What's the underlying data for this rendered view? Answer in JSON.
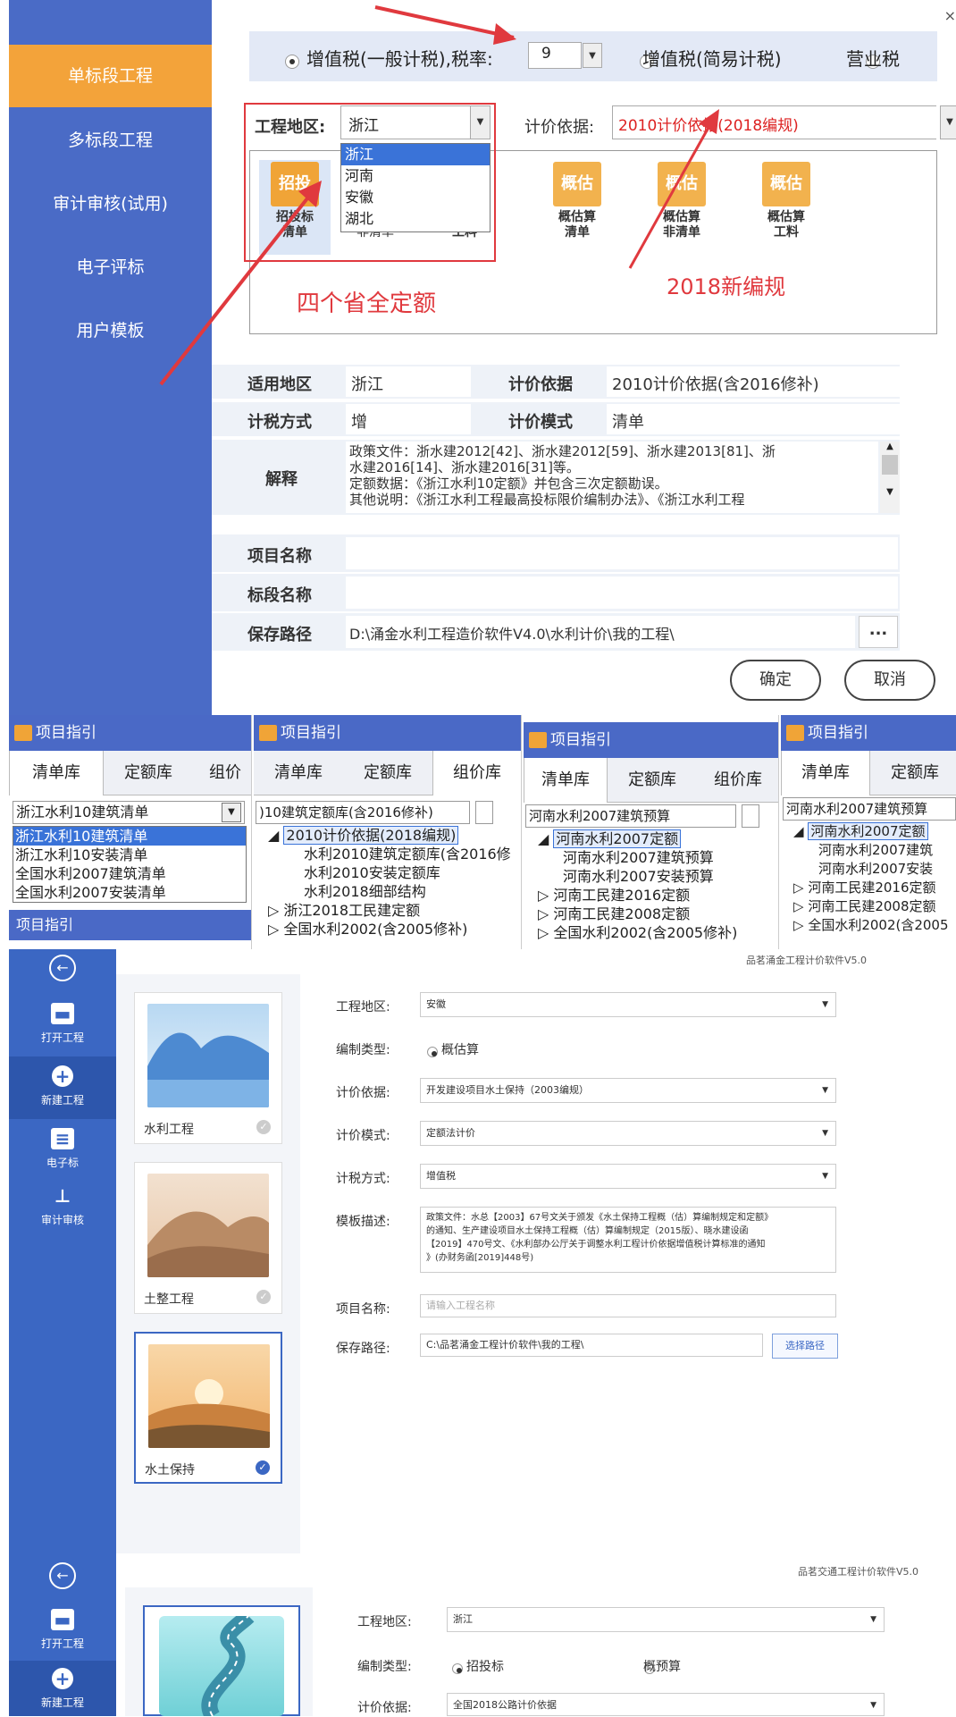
{
  "s1": {
    "sidebar": [
      "单标段工程",
      "多标段工程",
      "审计审核(试用)",
      "电子评标",
      "用户模板"
    ],
    "tax": {
      "opt1": "增值税(一般计税),税率:",
      "rate": "9",
      "opt2": "增值税(简易计税)",
      "opt3": "营业税"
    },
    "region_label": "工程地区:",
    "region_value": "浙江",
    "basis_label": "计价依据:",
    "basis_value": "2010计价依据(2018编规)",
    "region_options": [
      "浙江",
      "河南",
      "安徽",
      "湖北"
    ],
    "templates": [
      {
        "icon": "招投",
        "name": "招投标\n清单"
      },
      {
        "icon": "招投",
        "name": "\n非清单"
      },
      {
        "icon": "招投",
        "name": "招投标\n工料"
      },
      {
        "icon": "概估",
        "name": "概估算\n清单"
      },
      {
        "icon": "概估",
        "name": "概估算\n非清单"
      },
      {
        "icon": "概估",
        "name": "概估算\n工料"
      }
    ],
    "annot_left": "四个省全定额",
    "annot_right": "2018新编规",
    "info": {
      "area_label": "适用地区",
      "area_value": "浙江",
      "basis_label": "计价依据",
      "basis_value": "2010计价依据(含2016修补)",
      "taxmode_label": "计税方式",
      "taxmode_value": "增",
      "pricemode_label": "计价模式",
      "pricemode_value": "清单",
      "explain_label": "解释",
      "explain_lines": [
        "政策文件：浙水建2012[42]、浙水建2012[59]、浙水建2013[81]、浙",
        "水建2016[14]、浙水建2016[31]等。",
        "定额数据：《浙江水利10定额》并包含三次定额勘误。",
        "其他说明：《浙江水利工程最高投标限价编制办法》、《浙江水利工程"
      ]
    },
    "project_label": "项目名称",
    "section_label": "标段名称",
    "path_label": "保存路径",
    "path_value": "D:\\涌金水利工程造价软件V4.0\\水利计价\\我的工程\\",
    "browse": "...",
    "ok": "确定",
    "cancel": "取消"
  },
  "s2": {
    "title": "项目指引",
    "p1": {
      "tabs": [
        "清单库",
        "定额库",
        "组价"
      ],
      "combo": "浙江水利10建筑清单",
      "options": [
        "浙江水利10建筑清单",
        "浙江水利10安装清单",
        "全国水利2007建筑清单",
        "全国水利2007安装清单"
      ],
      "footer": "项目指引"
    },
    "p2": {
      "tabs": [
        "清单库",
        "定额库",
        "组价库"
      ],
      "combo": ")10建筑定额库(含2016修补)",
      "tree": [
        "2010计价依据(2018编规)",
        "水利2010建筑定额库(含2016修",
        "水利2010安装定额库",
        "水利2018细部结构",
        "浙江2018工民建定额",
        "全国水利2002(含2005修补)"
      ]
    },
    "p3": {
      "tabs": [
        "清单库",
        "定额库",
        "组价库"
      ],
      "combo": "河南水利2007建筑预算",
      "tree": [
        "河南水利2007定额",
        "河南水利2007建筑预算",
        "河南水利2007安装预算",
        "河南工民建2016定额",
        "河南工民建2008定额",
        "全国水利2002(含2005修补)"
      ]
    },
    "p4": {
      "tabs": [
        "清单库",
        "定额库"
      ],
      "combo": "河南水利2007建筑预算",
      "tree": [
        "河南水利2007定额",
        "河南水利2007建筑",
        "河南水利2007安装",
        "河南工民建2016定额",
        "河南工民建2008定额",
        "全国水利2002(含2005"
      ]
    }
  },
  "s3": {
    "title": "品茗涌金工程计价软件V5.0",
    "rail": [
      "打开工程",
      "新建工程",
      "电子标",
      "审计审核"
    ],
    "cards": [
      "水利工程",
      "土整工程",
      "水土保持"
    ],
    "region_label": "工程地区:",
    "region_value": "安徽",
    "type_label": "编制类型:",
    "type_value": "概估算",
    "basis_label": "计价依据:",
    "basis_value": "开发建设项目水土保持（2003编规）",
    "mode_label": "计价模式:",
    "mode_value": "定额法计价",
    "tax_label": "计税方式:",
    "tax_value": "增值税",
    "desc_label": "模板描述:",
    "desc_lines": [
      "政策文件：水总【2003】67号文关于颁发《水土保持工程概（估）算编制规定和定额》",
      "的通知、生产建设项目水土保持工程概（估）算编制规定（2015版）、晓水建设函",
      "【2019】470号文、《水利部办公厅关于调整水利工程计价依据增值税计算标准的通知",
      "》(办财务函[2019]448号)"
    ],
    "name_label": "项目名称:",
    "name_placeholder": "请输入工程名称",
    "path_label": "保存路径:",
    "path_value": "C:\\品茗涌金工程计价软件\\我的工程\\",
    "path_btn": "选择路径"
  },
  "s4": {
    "title": "品茗交通工程计价软件V5.0",
    "rail": [
      "打开工程",
      "新建工程"
    ],
    "region_label": "工程地区:",
    "region_value": "浙江",
    "type_label": "编制类型:",
    "type_opt1": "招投标",
    "type_opt2": "概预算",
    "basis_label": "计价依据:",
    "basis_value": "全国2018公路计价依据"
  },
  "colors": {
    "sidebar": "#4a6bc6",
    "active": "#f3a33a",
    "accent": "#3b67c3",
    "annotation": "#e0393e"
  }
}
